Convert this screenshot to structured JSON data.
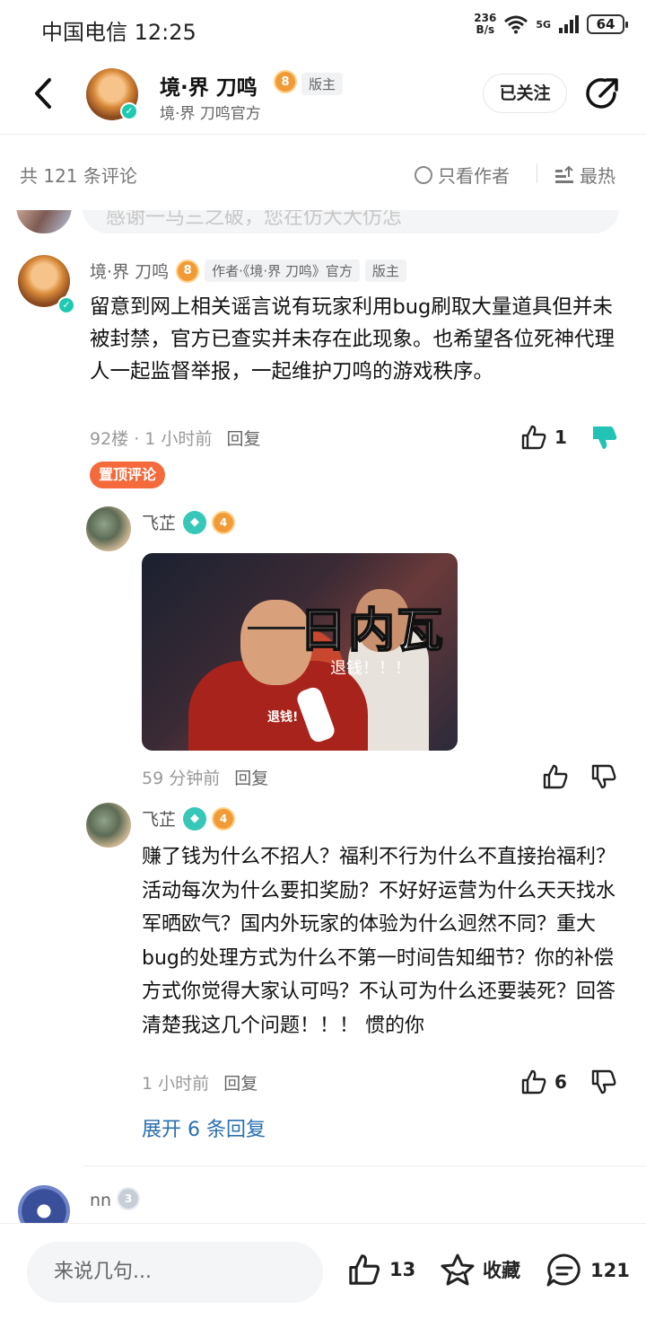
{
  "status": {
    "carrier_time": "中国电信 12:25",
    "speed_value": "236",
    "speed_unit": "B/s",
    "network": "5G",
    "battery": "64"
  },
  "header": {
    "title": "境·界 刀鸣",
    "subtitle": "境·界 刀鸣官方",
    "level": "8",
    "tag": "版主",
    "follow_label": "已关注"
  },
  "filter": {
    "count_label": "共 121 条评论",
    "only_author_label": "只看作者",
    "sort_label": "最热"
  },
  "prev_comment": {
    "text": "感谢一马三之破，您在仿大大仿怎"
  },
  "comment": {
    "author": "境·界 刀鸣",
    "level": "8",
    "author_tag": "作者·《境·界 刀鸣》官方",
    "role_tag": "版主",
    "text": "留意到网上相关谣言说有玩家利用bug刷取大量道具但并未被封禁，官方已查实并未存在此现象。也希望各位死神代理人一起监督举报，一起维护刀鸣的游戏秩序。",
    "floor_time": "92楼 · 1 小时前",
    "reply_label": "回复",
    "likes": "1",
    "pinned_label": "置顶评论"
  },
  "replies": [
    {
      "author": "飞芷",
      "level": "4",
      "meme_big_text": "日内瓦",
      "meme_small_text_1": "退钱！！！",
      "meme_small_text_2": "退钱!",
      "time": "59 分钟前",
      "reply_label": "回复"
    },
    {
      "author": "飞芷",
      "level": "4",
      "text": "赚了钱为什么不招人？福利不行为什么不直接抬福利？活动每次为什么要扣奖励？不好好运营为什么天天找水军晒欧气？国内外玩家的体验为什么迥然不同？重大bug的处理方式为什么不第一时间告知细节？你的补偿方式你觉得大家认可吗？不认可为什么还要装死？回答清楚我这几个问题！！！ 惯的你",
      "time": "1 小时前",
      "reply_label": "回复",
      "likes": "6"
    }
  ],
  "expand_label": "展开 6 条回复",
  "next_comment": {
    "author": "nn",
    "level": "3"
  },
  "bottom": {
    "input_placeholder": "来说几句...",
    "likes": "13",
    "favorite_label": "收藏",
    "comments": "121"
  },
  "colors": {
    "accent_orange": "#f46a3b",
    "link_blue": "#2a6fb0",
    "verified_teal": "#1ec9b2",
    "dislike_active": "#22c3b4"
  }
}
